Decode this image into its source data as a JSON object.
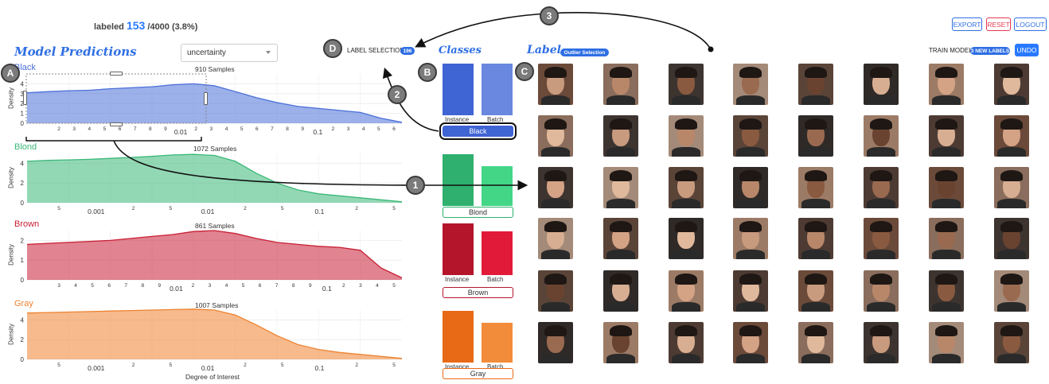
{
  "header": {
    "labeled_prefix": "labeled",
    "labeled_count": "153",
    "labeled_total": "/4000 (3.8%)",
    "buttons": {
      "export": "EXPORT",
      "reset": "RESET",
      "logout": "LOGOUT"
    }
  },
  "predictions": {
    "title": "Model Predictions",
    "dropdown_value": "uncertainty",
    "xlabel": "Degree of Interest",
    "ylabel": "Density"
  },
  "label_selection": {
    "text": "LABEL SELECTION",
    "count": "196"
  },
  "classes_title": "Classes",
  "label_panel": {
    "title": "Label",
    "badge": "Outlier Selection",
    "train_text": "TRAIN MODEL",
    "train_badge": "3 NEW LABELS",
    "undo": "UNDO"
  },
  "markers": [
    "A",
    "B",
    "C",
    "D",
    "1",
    "2",
    "3"
  ],
  "colors": {
    "accent": "#2f6fe4",
    "black": "#4a6fd8",
    "blond": "#3bb878",
    "brown": "#c81e34",
    "gray": "#ee8230"
  },
  "chart_data": [
    {
      "type": "area",
      "name": "Black",
      "samples": "910 Samples",
      "color": "#4a6fd8",
      "ylim": [
        0,
        4
      ],
      "yticks": [
        "0",
        "1",
        "2",
        "3",
        "4"
      ],
      "xticklabels": [
        "2",
        "3",
        "4",
        "5",
        "6",
        "7",
        "8",
        "9",
        "0.01",
        "2",
        "3",
        "4",
        "5",
        "6",
        "7",
        "8",
        "9",
        "0.1",
        "2",
        "3",
        "4",
        "5",
        "6"
      ],
      "y": [
        3.1,
        3.2,
        3.3,
        3.35,
        3.5,
        3.6,
        3.7,
        3.9,
        4.0,
        3.8,
        3.2,
        2.6,
        2.1,
        1.7,
        1.5,
        1.3,
        1.1,
        0.5,
        0.1
      ]
    },
    {
      "type": "area",
      "name": "Blond",
      "samples": "1072 Samples",
      "color": "#3bb878",
      "ylim": [
        0,
        4
      ],
      "yticks": [
        "0",
        "2",
        "4"
      ],
      "xticklabels": [
        "5",
        "0.001",
        "2",
        "5",
        "0.01",
        "2",
        "5",
        "0.1",
        "2",
        "5"
      ],
      "y": [
        4.2,
        4.3,
        4.35,
        4.4,
        4.5,
        4.6,
        4.7,
        4.85,
        4.9,
        4.8,
        4.2,
        3.0,
        2.0,
        1.3,
        0.9,
        0.7,
        0.5,
        0.3,
        0.1
      ]
    },
    {
      "type": "area",
      "name": "Brown",
      "samples": "861 Samples",
      "color": "#c81e34",
      "ylim": [
        0,
        2
      ],
      "yticks": [
        "0",
        "1",
        "2"
      ],
      "xticklabels": [
        "3",
        "4",
        "5",
        "6",
        "7",
        "8",
        "9",
        "0.01",
        "2",
        "3",
        "4",
        "5",
        "6",
        "7",
        "8",
        "9",
        "0.1",
        "2",
        "3",
        "4",
        "5"
      ],
      "y": [
        1.8,
        1.85,
        1.9,
        1.95,
        2.0,
        2.1,
        2.2,
        2.3,
        2.45,
        2.5,
        2.35,
        2.1,
        1.9,
        1.8,
        1.7,
        1.65,
        1.5,
        0.6,
        0.1
      ]
    },
    {
      "type": "area",
      "name": "Gray",
      "samples": "1007 Samples",
      "color": "#ee8230",
      "ylim": [
        0,
        4
      ],
      "yticks": [
        "0",
        "2",
        "4"
      ],
      "xticklabels": [
        "5",
        "0.001",
        "2",
        "5",
        "0.01",
        "2",
        "5",
        "0.1",
        "2",
        "5"
      ],
      "y": [
        4.7,
        4.75,
        4.8,
        4.85,
        4.9,
        4.95,
        5.0,
        5.05,
        5.1,
        5.0,
        4.5,
        3.5,
        2.4,
        1.5,
        1.0,
        0.7,
        0.5,
        0.3,
        0.1
      ]
    },
    {
      "type": "bar",
      "categories": [
        "Instance",
        "Batch"
      ],
      "series": [
        {
          "name": "Black",
          "values": [
            1.0,
            1.0
          ],
          "color": "#3f64d4"
        },
        {
          "name": "Blond",
          "values": [
            1.0,
            0.77
          ],
          "color": "#2fb06e"
        },
        {
          "name": "Brown",
          "values": [
            1.0,
            0.84
          ],
          "color": "#c81e34"
        },
        {
          "name": "Gray",
          "values": [
            1.0,
            0.77
          ],
          "color": "#ec7426"
        }
      ]
    }
  ]
}
